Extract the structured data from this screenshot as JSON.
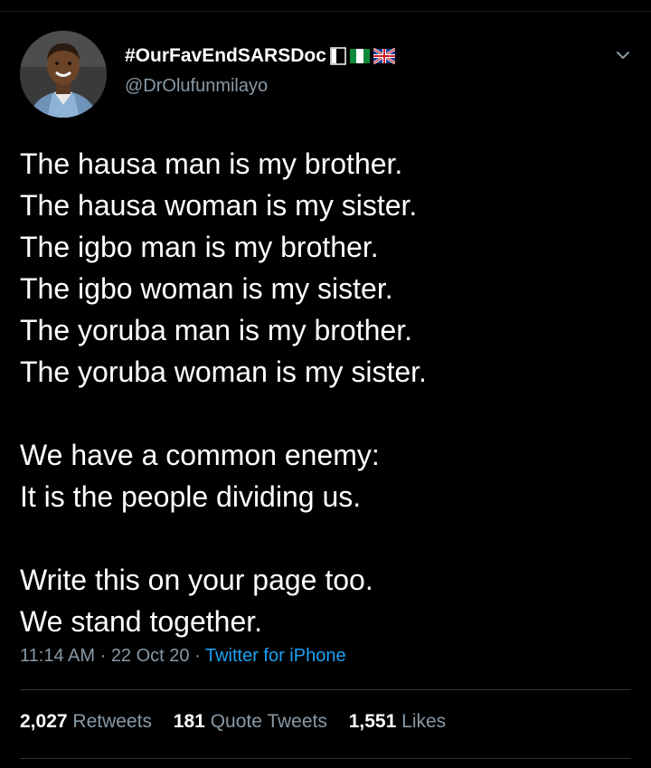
{
  "user": {
    "display_name": "#OurFavEndSARSDoc",
    "handle": "@DrOlufunmilayo",
    "flags": [
      "nigeria-flag-icon",
      "uk-flag-icon"
    ]
  },
  "tweet": {
    "lines": [
      "The hausa man is my brother.",
      "The hausa woman is my sister.",
      "The igbo man is my brother.",
      "The igbo woman is my sister.",
      "The yoruba man is my brother.",
      "The yoruba woman is my sister.",
      "",
      "We have a common enemy:",
      "It is the people dividing us.",
      "",
      "Write this on your page too.",
      "We stand together."
    ],
    "time": "11:14 AM",
    "separator": " · ",
    "date": "22 Oct 20",
    "source": "Twitter for iPhone"
  },
  "stats": {
    "retweets_count": "2,027",
    "retweets_label": "Retweets",
    "quote_count": "181",
    "quote_label": "Quote Tweets",
    "likes_count": "1,551",
    "likes_label": "Likes"
  },
  "colors": {
    "background": "#000000",
    "text": "#ffffff",
    "secondary": "#8899a6",
    "link": "#1da1f2"
  }
}
